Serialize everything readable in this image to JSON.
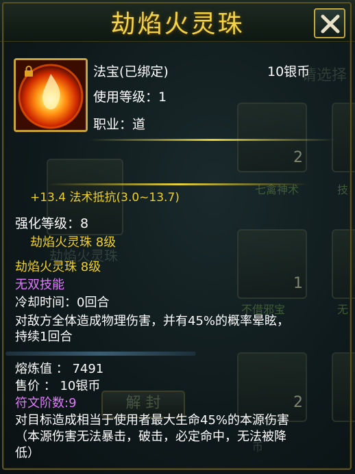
{
  "window": {
    "title": "劫焰火灵珠",
    "close_icon": "close-icon"
  },
  "item": {
    "icon": "fire-orb-icon",
    "type_label": "法宝(已绑定)",
    "price_header": "10银币",
    "use_level": "使用等级：1",
    "profession": "职业：道",
    "stat_line": "+13.4 法术抵抗(3.0~13.7)",
    "enhance_level": "强化等级：8",
    "enhance_name": "劫焰火灵珠 8级",
    "name_level": "劫焰火灵珠 8级",
    "skill_header": "无双技能",
    "cooldown": "冷却时间：0回合",
    "skill_desc_1": "对敌方全体造成物理伤害，并有45%的概率晕眩，",
    "skill_desc_2": "持续1回合",
    "smelt_value": "熔炼值 ： 7491",
    "sell_price": "售价 ： 10银币",
    "rune_level": "符文阶数:9",
    "rune_desc_1": "对目标造成相当于使用者最大生命45%的本源伤害",
    "rune_desc_2": "（本源伤害无法暴击，破击，必定命中，无法被降",
    "rune_desc_3": "低）"
  },
  "background": {
    "slot_label_1": "七禽神术",
    "slot_label_2": "技",
    "slot_label_3": "不借邪宝",
    "slot_label_4": "无",
    "slot_count_1": "2",
    "slot_count_2": "1",
    "slot_count_3": "2",
    "ghost_text_1": "请选择",
    "ghost_text_2": "劫焰火灵珠",
    "ghost_button": "解 封",
    "ghost_small": "币"
  },
  "colors": {
    "title": "#f2d54a",
    "yellow_text": "#f0d02a",
    "skill_text": "#e27bff",
    "border": "#c8a43a"
  }
}
